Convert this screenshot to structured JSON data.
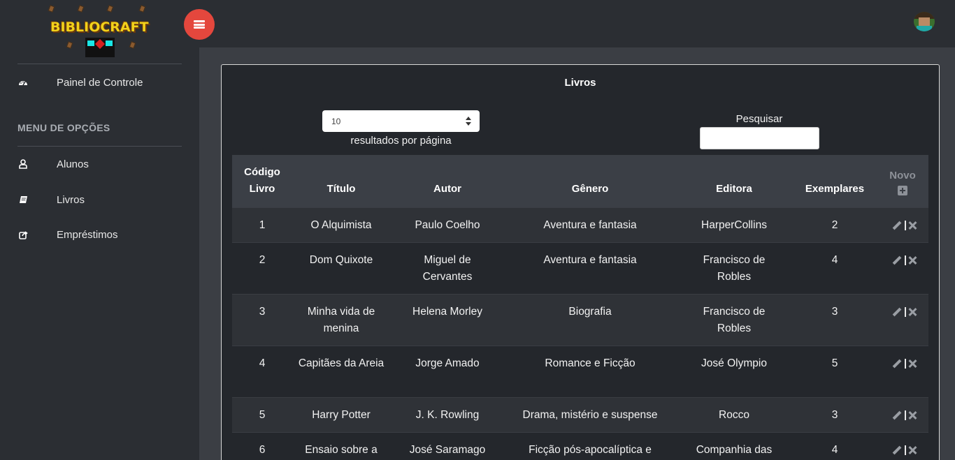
{
  "app": {
    "logo_text": "BIBLIOCRAFT"
  },
  "sidebar": {
    "items": [
      {
        "label": "Painel de Controle",
        "icon": "dashboard-icon"
      },
      {
        "label": "Alunos",
        "icon": "user-icon"
      },
      {
        "label": "Livros",
        "icon": "book-icon"
      },
      {
        "label": "Empréstimos",
        "icon": "share-icon"
      }
    ],
    "menu_heading": "MENU DE OPÇÕES"
  },
  "topbar": {
    "menu_button_icon": "hamburger-icon",
    "avatar_icon": "user-avatar"
  },
  "colors": {
    "accent": "#e4473d",
    "background": "#2b2e33",
    "card": "#24272c"
  },
  "card": {
    "title": "Livros"
  },
  "length": {
    "value": "10",
    "label": "resultados por página"
  },
  "search": {
    "label": "Pesquisar",
    "value": ""
  },
  "table": {
    "headers": {
      "codigo": "Código Livro",
      "titulo": "Título",
      "autor": "Autor",
      "genero": "Gênero",
      "editora": "Editora",
      "exemplares": "Exemplares",
      "novo": "Novo"
    },
    "rows": [
      {
        "codigo": "1",
        "titulo": "O Alquimista",
        "autor": "Paulo Coelho",
        "genero": "Aventura e fantasia",
        "editora": "HarperCollins",
        "exemplares": "2"
      },
      {
        "codigo": "2",
        "titulo": "Dom Quixote",
        "autor": "Miguel de Cervantes",
        "genero": "Aventura e fantasia",
        "editora": "Francisco de Robles",
        "exemplares": "4"
      },
      {
        "codigo": "3",
        "titulo": "Minha vida de menina",
        "autor": "Helena Morley",
        "genero": "Biografia",
        "editora": "Francisco de Robles",
        "exemplares": "3"
      },
      {
        "codigo": "4",
        "titulo": "Capitães da Areia",
        "autor": "Jorge Amado",
        "genero": "Romance e Ficção",
        "editora": "José Olympio",
        "exemplares": "5"
      },
      {
        "codigo": "5",
        "titulo": "Harry Potter",
        "autor": "J. K. Rowling",
        "genero": "Drama, mistério e suspense",
        "editora": "Rocco",
        "exemplares": "3"
      },
      {
        "codigo": "6",
        "titulo": "Ensaio sobre a",
        "autor": "José Saramago",
        "genero": "Ficção pós-apocalíptica e",
        "editora": "Companhia das",
        "exemplares": "4"
      }
    ]
  }
}
